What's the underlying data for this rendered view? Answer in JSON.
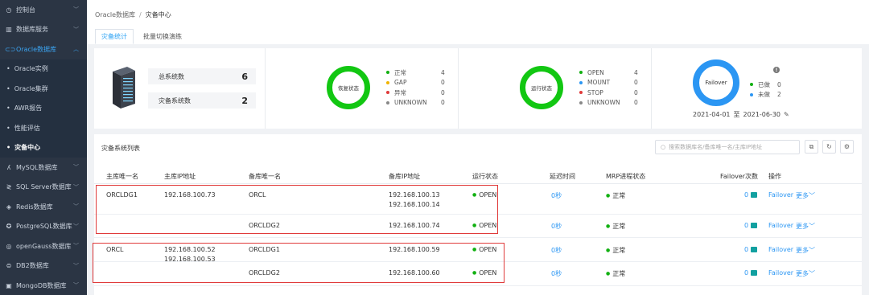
{
  "sidebar": {
    "items": [
      {
        "label": "控制台",
        "icon": "dashboard-icon",
        "glyph": "◷"
      },
      {
        "label": "数据库服务",
        "icon": "bar-chart-icon",
        "glyph": "▥"
      },
      {
        "label": "Oracle数据库",
        "icon": "database-icon",
        "glyph": "⊂⊃"
      }
    ],
    "sub_items": [
      {
        "label": "Oracle实例"
      },
      {
        "label": "Oracle集群"
      },
      {
        "label": "AWR报告"
      },
      {
        "label": "性能评估"
      },
      {
        "label": "灾备中心"
      }
    ],
    "items_after": [
      {
        "label": "MySQL数据库",
        "icon": "dolphin-icon",
        "glyph": "ʎ"
      },
      {
        "label": "SQL Server数据库",
        "icon": "sqlserver-icon",
        "glyph": "≷"
      },
      {
        "label": "Redis数据库",
        "icon": "redis-icon",
        "glyph": "◈"
      },
      {
        "label": "PostgreSQL数据库",
        "icon": "elephant-icon",
        "glyph": "✪"
      },
      {
        "label": "openGauss数据库",
        "icon": "opengauss-icon",
        "glyph": "◎"
      },
      {
        "label": "DB2数据库",
        "icon": "db2-icon",
        "glyph": "⊜"
      },
      {
        "label": "MongoDB数据库",
        "icon": "mongodb-icon",
        "glyph": "▣"
      }
    ]
  },
  "breadcrumb": {
    "parent": "Oracle数据库",
    "separator": "/",
    "current": "灾备中心"
  },
  "tabs": [
    {
      "label": "灾备统计"
    },
    {
      "label": "批量切换演练"
    }
  ],
  "summary": {
    "total_label": "总系统数",
    "total_value": "6",
    "dr_label": "灾备系统数",
    "dr_value": "2"
  },
  "recovery": {
    "ring_label": "恢复状态",
    "legend": [
      {
        "label": "正常",
        "value": "4",
        "color": "#12b012"
      },
      {
        "label": "GAP",
        "value": "0",
        "color": "#f0b400"
      },
      {
        "label": "异常",
        "value": "0",
        "color": "#e03b3b"
      },
      {
        "label": "UNKNOWN",
        "value": "0",
        "color": "#888888"
      }
    ]
  },
  "running": {
    "ring_label": "运行状态",
    "legend": [
      {
        "label": "OPEN",
        "value": "4",
        "color": "#12b012"
      },
      {
        "label": "MOUNT",
        "value": "0",
        "color": "#2b96f3"
      },
      {
        "label": "STOP",
        "value": "0",
        "color": "#e03b3b"
      },
      {
        "label": "UNKNOWN",
        "value": "0",
        "color": "#888888"
      }
    ]
  },
  "failover": {
    "ring_label": "Failover",
    "legend": [
      {
        "label": "已做",
        "value": "0",
        "color": "#12b012"
      },
      {
        "label": "未做",
        "value": "2",
        "color": "#2b96f3"
      }
    ],
    "date_from": "2021-04-01",
    "date_to_word": "至",
    "date_to": "2021-06-30"
  },
  "list": {
    "title": "灾备系统列表",
    "search_placeholder": "搜索数据库名/备库唯一名/主库IP地址",
    "columns": [
      "主库唯一名",
      "主库IP地址",
      "备库唯一名",
      "备库IP地址",
      "运行状态",
      "延迟时间",
      "MRP进程状态",
      "Failover次数",
      "操作"
    ],
    "groups": [
      {
        "primary_name": "ORCLDG1",
        "primary_ip": [
          "192.168.100.73"
        ],
        "rows": [
          {
            "standby_name": "ORCL",
            "standby_ip": [
              "192.168.100.13",
              "192.168.100.14"
            ],
            "status": "OPEN",
            "delay": "0秒",
            "mrp": "正常",
            "failover_count": "0",
            "action": "Failover",
            "more": "更多"
          },
          {
            "standby_name": "ORCLDG2",
            "standby_ip": [
              "192.168.100.74"
            ],
            "status": "OPEN",
            "delay": "0秒",
            "mrp": "正常",
            "failover_count": "0",
            "action": "Failover",
            "more": "更多"
          }
        ]
      },
      {
        "primary_name": "ORCL",
        "primary_ip": [
          "192.168.100.52",
          "192.168.100.53"
        ],
        "rows": [
          {
            "standby_name": "ORCLDG1",
            "standby_ip": [
              "192.168.100.59"
            ],
            "status": "OPEN",
            "delay": "0秒",
            "mrp": "正常",
            "failover_count": "0",
            "action": "Failover",
            "more": "更多"
          },
          {
            "standby_name": "ORCLDG2",
            "standby_ip": [
              "192.168.100.60"
            ],
            "status": "OPEN",
            "delay": "0秒",
            "mrp": "正常",
            "failover_count": "0",
            "action": "Failover",
            "more": "更多"
          }
        ]
      }
    ]
  }
}
